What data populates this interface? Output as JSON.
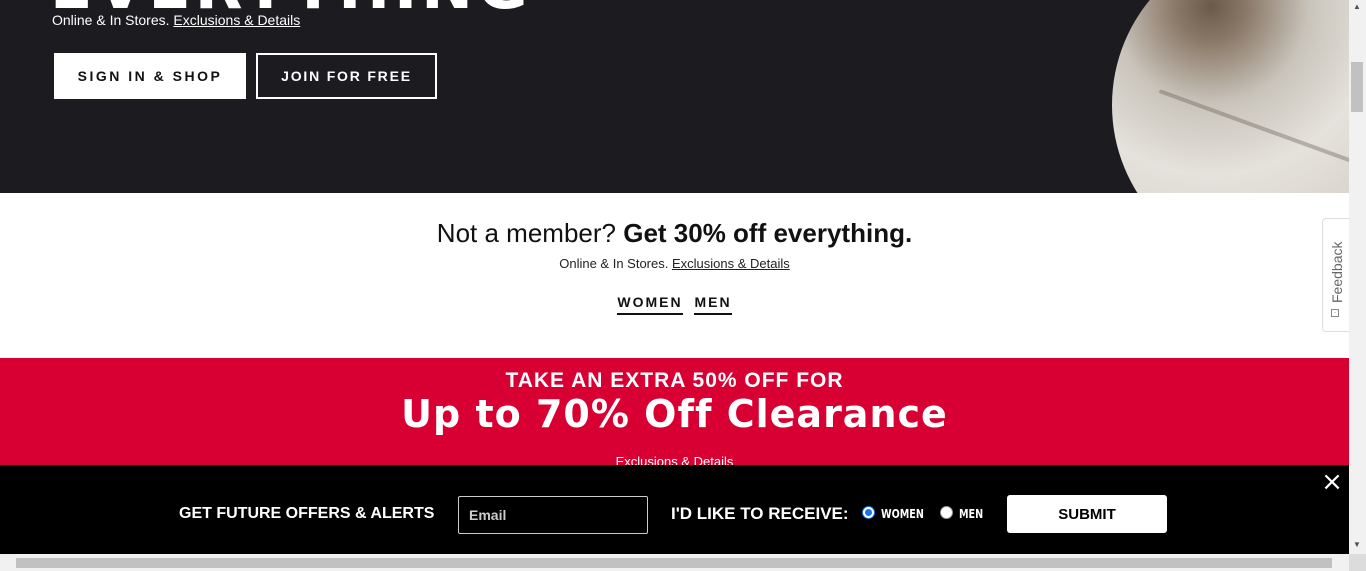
{
  "hero": {
    "headline": "EVERYTHING",
    "subtext": "Online & In Stores.",
    "details_link": "Exclusions & Details",
    "signin_button": "SIGN IN & SHOP",
    "join_button": "JOIN FOR FREE"
  },
  "member": {
    "title_plain": "Not a member?",
    "title_bold": "Get 30% off everything.",
    "subtext": "Online & In Stores.",
    "details_link": "Exclusions & Details",
    "links": [
      "WOMEN",
      "MEN"
    ]
  },
  "clearance": {
    "eyebrow": "TAKE AN EXTRA 50% OFF FOR",
    "title": "Up to 70% Off Clearance",
    "details_link": "Exclusions & Details"
  },
  "feedback": {
    "label": "Feedback"
  },
  "signup_bar": {
    "label": "GET FUTURE OFFERS & ALERTS",
    "email_placeholder": "Email",
    "receive_label": "I'D LIKE TO RECEIVE:",
    "options": [
      {
        "label": "WOMEN",
        "checked": true
      },
      {
        "label": "MEN",
        "checked": false
      }
    ],
    "submit_label": "SUBMIT",
    "close_icon": "×"
  },
  "colors": {
    "hero_bg": "#1b1b20",
    "clearance_red": "#d80032",
    "bar_bg": "#000000"
  }
}
